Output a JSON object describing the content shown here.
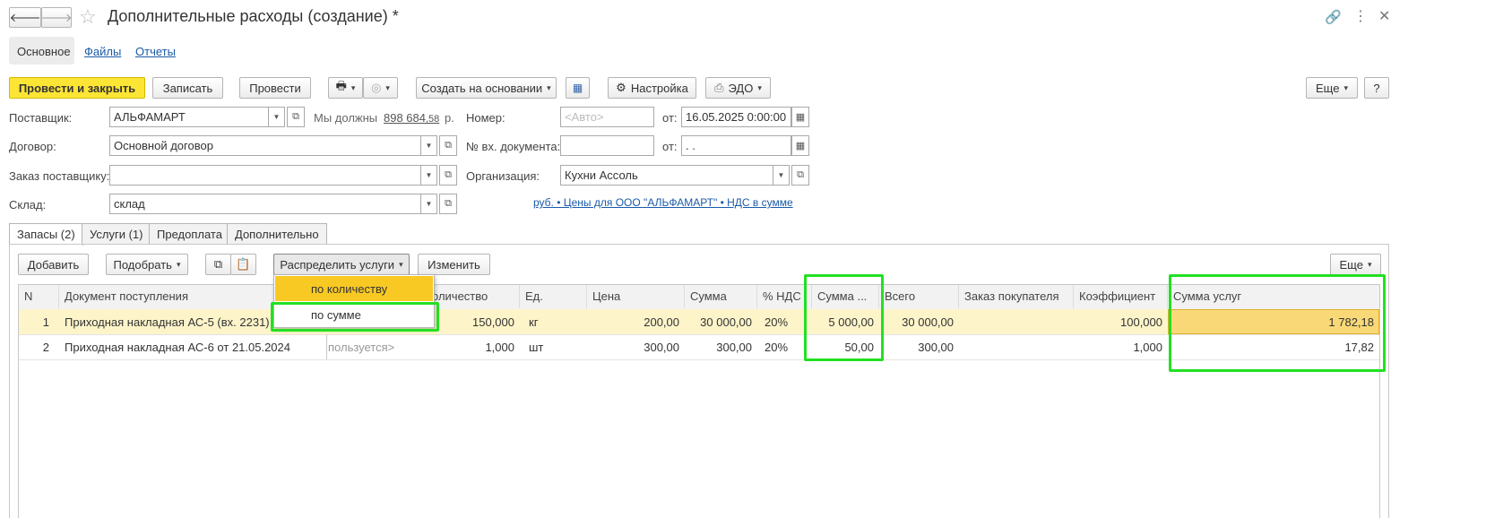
{
  "window": {
    "title": "Дополнительные расходы (создание) *"
  },
  "nav_tabs": [
    "Основное",
    "Файлы",
    "Отчеты"
  ],
  "toolbar": {
    "post_close": "Провести и закрыть",
    "save": "Записать",
    "post": "Провести",
    "create_based": "Создать на основании",
    "settings": "Настройка",
    "edo": "ЭДО",
    "more": "Еще",
    "help": "?"
  },
  "form": {
    "supplier_label": "Поставщик:",
    "supplier_value": "АЛЬФАМАРТ",
    "debt_text": "Мы должны",
    "debt_amount": "898 684",
    "debt_kop": ",58",
    "debt_cur": "р.",
    "number_label": "Номер:",
    "number_placeholder": "<Авто>",
    "from_label": "от:",
    "date_value": "16.05.2025  0:00:00",
    "contract_label": "Договор:",
    "contract_value": "Основной договор",
    "incoming_doc_label": "№ вх. документа:",
    "incoming_doc_value": "",
    "from2_label": "от:",
    "date2_value": "  .  .",
    "order_label": "Заказ поставщику:",
    "order_value": "",
    "org_label": "Организация:",
    "org_value": "Кухни Ассоль",
    "warehouse_label": "Склад:",
    "warehouse_value": "склад",
    "price_link": "руб. • Цены для ООО \"АЛЬФАМАРТ\" • НДС в сумме"
  },
  "doc_tabs": [
    "Запасы (2)",
    "Услуги (1)",
    "Предоплата",
    "Дополнительно"
  ],
  "table_toolbar": {
    "add": "Добавить",
    "pick": "Подобрать",
    "distribute": "Распределить услуги",
    "change": "Изменить",
    "more": "Еще"
  },
  "dropdown": {
    "items": [
      "по количеству",
      "по сумме"
    ]
  },
  "table": {
    "headers": [
      "N",
      "Документ поступления",
      "Количество",
      "Ед.",
      "Цена",
      "Сумма",
      "% НДС",
      "Сумма ...",
      "Всего",
      "Заказ покупателя",
      "Коэффициент",
      "Сумма услуг"
    ],
    "header_qty_visible": "оличество",
    "rows": [
      {
        "n": "1",
        "doc": "Приходная накладная АС-5 (вх. 2231) от",
        "qty": "150,000",
        "unit": "кг",
        "price": "200,00",
        "sum": "30 000,00",
        "vat": "20%",
        "vat_sum": "5 000,00",
        "total": "30 000,00",
        "order": "",
        "coef": "100,000",
        "service_sum": "1 782,18"
      },
      {
        "n": "2",
        "doc": "Приходная накладная АС-6 от 21.05.2024",
        "qty_note": "пользуется>",
        "qty": "1,000",
        "unit": "шт",
        "price": "300,00",
        "sum": "300,00",
        "vat": "20%",
        "vat_sum": "50,00",
        "total": "300,00",
        "order": "",
        "coef": "1,000",
        "service_sum": "17,82"
      }
    ]
  },
  "colors": {
    "primary_button": "#fde535",
    "highlight": "#22e022",
    "selected_row": "#fdf4c9",
    "dropdown_active": "#f9c923"
  }
}
